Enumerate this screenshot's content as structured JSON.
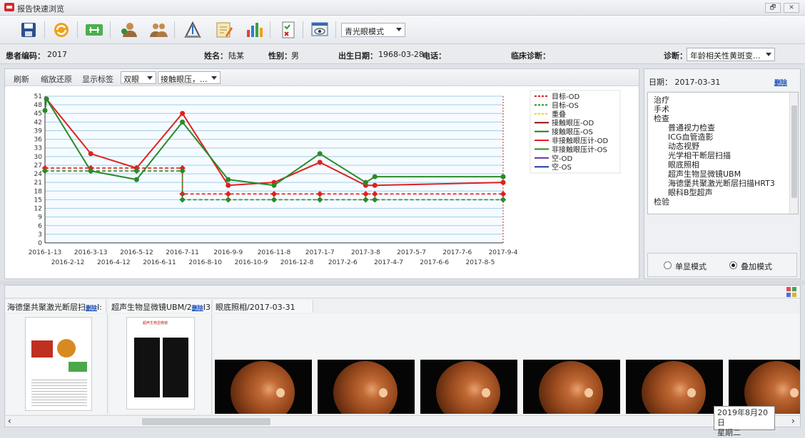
{
  "window": {
    "title": "报告快速浏览",
    "restore_label": "🗗",
    "close_label": "✕"
  },
  "toolbar": {
    "mode_value": "青光眼模式"
  },
  "info": {
    "patient_id_label": "患者编码：",
    "patient_id": "2017",
    "name_label": "姓名：",
    "name": "陆某",
    "sex_label": "性别：",
    "sex": "男",
    "dob_label": "出生日期：",
    "dob": "1968-03-28",
    "phone_label": "电话：",
    "phone": "",
    "clinical_label": "临床诊断：",
    "clinical": "",
    "diag_label": "诊断：",
    "diag_value": "年龄相关性黄斑变..."
  },
  "chart_toolbar": {
    "refresh": "刷新",
    "reset_zoom": "缩放还原",
    "show_labels": "显示标签",
    "eye_value": "双眼",
    "series_value": "接触眼压，..."
  },
  "chart_data": {
    "type": "line",
    "ylim": [
      0,
      51
    ],
    "yticks": [
      0,
      3,
      6,
      9,
      12,
      15,
      18,
      21,
      24,
      27,
      30,
      33,
      36,
      39,
      42,
      45,
      48,
      51
    ],
    "xticks_top": [
      "2016-1-13",
      "2016-3-13",
      "2016-5-12",
      "2016-7-11",
      "2016-9-9",
      "2016-11-8",
      "2017-1-7",
      "2017-3-8",
      "2017-5-7",
      "2017-7-6",
      "2017-9-4"
    ],
    "xticks_bottom": [
      "2016-2-12",
      "2016-4-12",
      "2016-6-11",
      "2016-8-10",
      "2016-10-9",
      "2016-12-8",
      "2017-2-6",
      "2017-4-7",
      "2017-6-6",
      "2017-8-5"
    ],
    "x_start": "2016-1-13",
    "x_end": "2017-9-4",
    "legend": [
      {
        "name": "目标-OD",
        "color": "#e02020",
        "dash": true
      },
      {
        "name": "目标-OS",
        "color": "#2a8a2a",
        "dash": true
      },
      {
        "name": "重叠",
        "color": "#e8d020",
        "dash": true
      },
      {
        "name": "接触眼压-OD",
        "color": "#8a1010",
        "dash": false
      },
      {
        "name": "接触眼压-OS",
        "color": "#1f7a1f",
        "dash": false
      },
      {
        "name": "非接触眼压计-OD",
        "color": "#e02020",
        "dash": false
      },
      {
        "name": "非接触眼压计-OS",
        "color": "#2a8a2a",
        "dash": false
      },
      {
        "name": "空-OD",
        "color": "#6030a0",
        "dash": false
      },
      {
        "name": "空-OS",
        "color": "#1a3aa0",
        "dash": false
      }
    ],
    "series": [
      {
        "name": "非接触眼压计-OD",
        "color": "#e02020",
        "dash": false,
        "points": [
          [
            "2016-1-15",
            50
          ],
          [
            "2016-3-13",
            31
          ],
          [
            "2016-5-12",
            26
          ],
          [
            "2016-7-11",
            45
          ],
          [
            "2016-9-9",
            20
          ],
          [
            "2016-11-8",
            21
          ],
          [
            "2017-1-7",
            28
          ],
          [
            "2017-3-8",
            20
          ],
          [
            "2017-3-20",
            20
          ],
          [
            "2017-9-4",
            21
          ]
        ]
      },
      {
        "name": "接触眼压-OS",
        "color": "#2a8a2a",
        "dash": false,
        "points": [
          [
            "2016-1-13",
            46
          ],
          [
            "2016-1-15",
            50
          ],
          [
            "2016-3-13",
            25
          ],
          [
            "2016-5-12",
            22
          ],
          [
            "2016-7-11",
            42
          ],
          [
            "2016-9-9",
            22
          ],
          [
            "2016-11-8",
            20
          ],
          [
            "2017-1-7",
            31
          ],
          [
            "2017-3-8",
            21
          ],
          [
            "2017-3-20",
            23
          ],
          [
            "2017-9-4",
            23
          ]
        ]
      },
      {
        "name": "目标-OD",
        "color": "#e02020",
        "dash": true,
        "points": [
          [
            "2016-1-13",
            26
          ],
          [
            "2016-3-13",
            26
          ],
          [
            "2016-5-12",
            26
          ],
          [
            "2016-7-11",
            26
          ],
          [
            "2016-7-11",
            17
          ],
          [
            "2016-9-9",
            17
          ],
          [
            "2016-11-8",
            17
          ],
          [
            "2017-1-7",
            17
          ],
          [
            "2017-3-8",
            17
          ],
          [
            "2017-3-20",
            17
          ],
          [
            "2017-9-4",
            17
          ]
        ]
      },
      {
        "name": "目标-OS",
        "color": "#2a8a2a",
        "dash": true,
        "points": [
          [
            "2016-1-13",
            25
          ],
          [
            "2016-3-13",
            25
          ],
          [
            "2016-5-12",
            25
          ],
          [
            "2016-7-11",
            25
          ],
          [
            "2016-7-11",
            15
          ],
          [
            "2016-9-9",
            15
          ],
          [
            "2016-11-8",
            15
          ],
          [
            "2017-1-7",
            15
          ],
          [
            "2017-3-8",
            15
          ],
          [
            "2017-3-20",
            15
          ],
          [
            "2017-9-4",
            15
          ]
        ]
      }
    ]
  },
  "right": {
    "date_label": "日期：",
    "date_value": "2017-03-31",
    "delete_label": "删除",
    "tree": [
      "治疗",
      "手术",
      "检查",
      "普通视力检查",
      "ICG血管造影",
      "动态视野",
      "光学相干断层扫描",
      "眼底照相",
      "超声生物显微镜UBM",
      "海德堡共聚激光断层扫描HRT3",
      "眼科B型超声",
      "检验"
    ],
    "mode_single": "单显模式",
    "mode_overlay": "叠加模式"
  },
  "thumbs": {
    "tab1": "海德堡共聚激光断层扫",
    "tab1_del": "删除",
    "tab1_tail": "I:",
    "tab2": "超声生物显微镜UBM/2",
    "tab2_del": "删除",
    "tab2_tail": "I3",
    "tab3": "眼底照相/2017-03-31",
    "ubm_title": "超声生物显微镜"
  },
  "scroll": {
    "left": "‹",
    "right": "›"
  },
  "tooltip": {
    "date": "2019年8月20日",
    "weekday": "星期二"
  }
}
